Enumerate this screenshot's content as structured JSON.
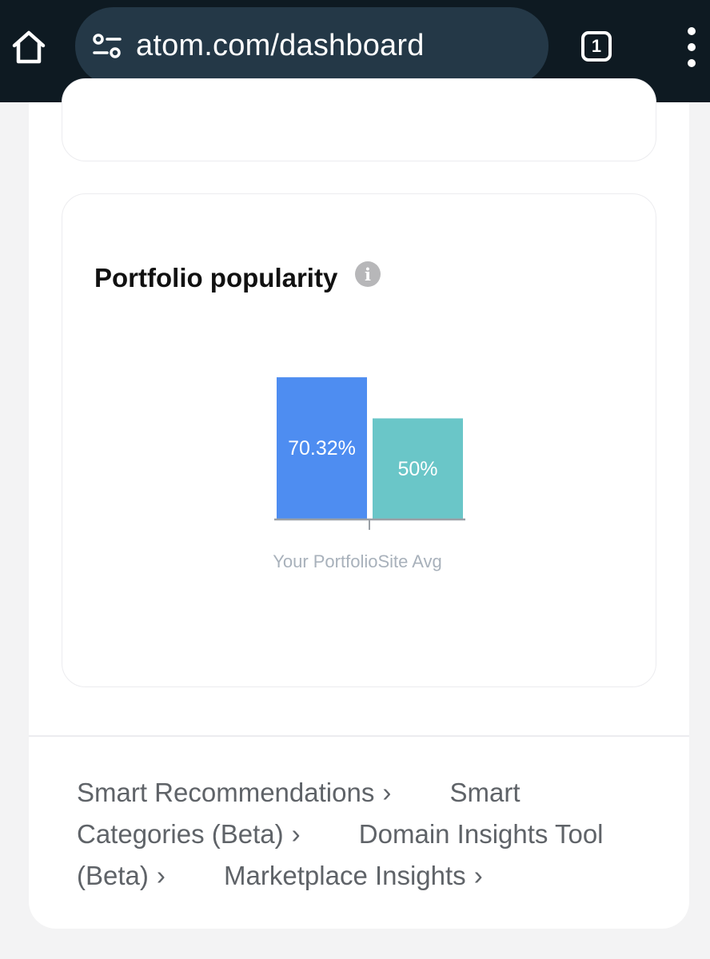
{
  "browser": {
    "url": "atom.com/dashboard",
    "tab_count": "1"
  },
  "popularity_card": {
    "title": "Portfolio popularity",
    "info_icon_glyph": "i"
  },
  "chart_data": {
    "type": "bar",
    "categories": [
      "Your Portfolio",
      "Site Avg"
    ],
    "values": [
      70.32,
      50
    ],
    "value_labels": [
      "70.32%",
      "50%"
    ],
    "colors": [
      "#4e8df1",
      "#6ac6c8"
    ],
    "ylim": [
      0,
      100
    ]
  },
  "footer_links": [
    {
      "label": "Smart Recommendations",
      "chevron": "›"
    },
    {
      "label": "Smart Categories (Beta)",
      "chevron": "›"
    },
    {
      "label": "Domain Insights Tool (Beta)",
      "chevron": "›"
    },
    {
      "label": "Marketplace Insights",
      "chevron": "›"
    }
  ],
  "icons": {
    "home": "home-icon",
    "site_info": "site-info-icon",
    "tabs": "tabs-icon",
    "menu": "more-vert-icon"
  }
}
